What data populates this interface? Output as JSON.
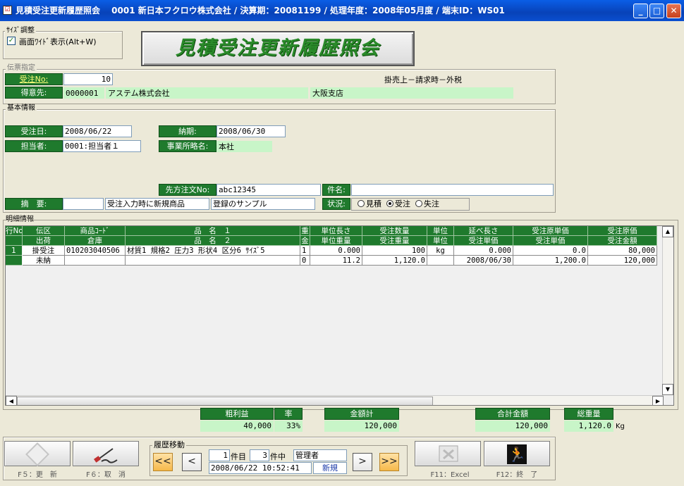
{
  "window": {
    "title": "見積受注更新履歴照会　 0001 新日本フクロウ株式会社 / 決算期：20081199 / 処理年度：2008年05月度 / 端末ID：WS01",
    "icon_glyph": "☑",
    "minimize": "_",
    "maximize": "□",
    "close": "✕"
  },
  "size_adjust": {
    "group_label": "ｻｲｽﾞ調整",
    "checkbox_mark": "✓",
    "checkbox_label": "画面ﾜｲﾄﾞ表示(Alt+W)"
  },
  "form_title": "見積受注更新履歴照会",
  "slip": {
    "group_label": "伝票指定",
    "order_no_label": "受注No:",
    "order_no": "10",
    "sale_type": "掛売上－請求時－外税",
    "customer_label": "得意先:",
    "customer_code": "0000001",
    "customer_name": "アステム株式会社",
    "branch": "大阪支店"
  },
  "basic": {
    "group_label": "基本情報",
    "order_date_label": "受注日:",
    "order_date": "2008/06/22",
    "delivery_label": "納期:",
    "delivery": "2008/06/30",
    "staff_label": "担当者:",
    "staff": "0001:担当者１",
    "office_label": "事業所略名:",
    "office": "本社",
    "cust_order_label": "先方注文No:",
    "cust_order": "abc12345",
    "subject_label": "件名:",
    "subject": "",
    "memo_label": "摘　要:",
    "memo_code": "",
    "memo_text1": "受注入力時に新規商品",
    "memo_text2": "登録のサンプル",
    "status_label": "状況:",
    "status_options": [
      "見積",
      "受注",
      "失注"
    ],
    "status_selected": "受注"
  },
  "detail": {
    "group_label": "明細情報",
    "header_row1": [
      "行No",
      "伝区",
      "商品ｺｰﾄﾞ",
      "品　名　１",
      "重",
      "単位長さ",
      "受注数量",
      "単位",
      "延べ長さ",
      "受注原単価",
      "受注原価"
    ],
    "header_row2": [
      "",
      "出荷",
      "倉庫",
      "品　名　２",
      "金",
      "単位重量",
      "受注重量",
      "単位",
      "受注単価",
      "受注単価",
      "受注金額"
    ],
    "rows": [
      {
        "line1": [
          "1",
          "掛受注",
          "010203040506",
          "材質1 規格2 圧力3 形状4 区分6 ｻｲｽﾞ5",
          "1",
          "0.000",
          "100",
          "kg",
          "0.000",
          "0.0",
          "80,000"
        ],
        "line2": [
          "",
          "未納",
          "",
          "",
          "0",
          "11.2",
          "1,120.0",
          "",
          "2008/06/30",
          "1,200.0",
          "120,000"
        ]
      }
    ],
    "scroll_up": "▲",
    "scroll_down": "▼",
    "scroll_left": "◀",
    "scroll_right": "▶"
  },
  "summary": {
    "gross_profit_label": "粗利益",
    "rate_label": "率",
    "gross_profit": "40,000",
    "rate": "33%",
    "amount_total_label": "金額計",
    "amount_total": "120,000",
    "grand_total_label": "合計金額",
    "grand_total": "120,000",
    "total_weight_label": "総重量",
    "total_weight": "1,120.0",
    "weight_unit": "Kg"
  },
  "footer": {
    "f5_caption": "F５：更　新",
    "f6_caption": "F６：取　消",
    "history_label": "履歴移動",
    "first_btn": "<<",
    "prev_btn": "<",
    "next_btn": ">",
    "last_btn": ">>",
    "current_no": "1",
    "current_suffix": "件目",
    "total_no": "3",
    "total_suffix": "件中",
    "user": "管理者",
    "timestamp": "2008/06/22 10:52:41",
    "mode": "新規",
    "f11_caption": "F11：Excel",
    "f12_caption": "F12：終　了"
  },
  "colors": {
    "accent_green": "#1f7a2d",
    "field_green": "#c8f5c8",
    "title_text": "#2a8a2a",
    "nav_orange": "#f6b94a"
  }
}
